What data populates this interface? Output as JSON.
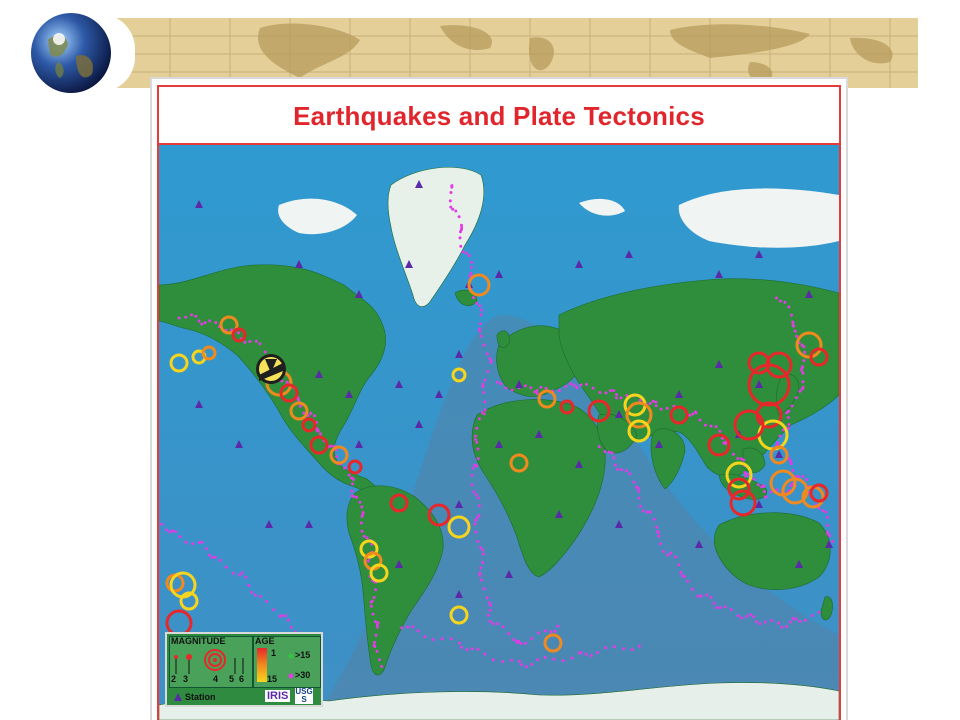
{
  "title": "Earthquakes and Plate Tectonics",
  "legend": {
    "magnitude_label": "MAGNITUDE",
    "magnitude_scale": [
      "2",
      "3",
      "4",
      "5",
      "6"
    ],
    "age_label": "AGE",
    "age_ticks": [
      "1",
      "15"
    ],
    "age_dot_labels": [
      ">15",
      ">30"
    ],
    "station_label": "Station",
    "logo_iris": "IRIS",
    "logo_usgs": "USGS"
  },
  "colors": {
    "title": "#e0262c",
    "ocean": "#3c9ac9",
    "land": "#2f8e3c",
    "ice": "#f2f6f4",
    "station": "#5a2aa8",
    "quake_dots": "#e33be6",
    "quake_recent": "#e8272b",
    "quake_mid": "#f18a1e",
    "quake_older": "#f7d51c"
  }
}
